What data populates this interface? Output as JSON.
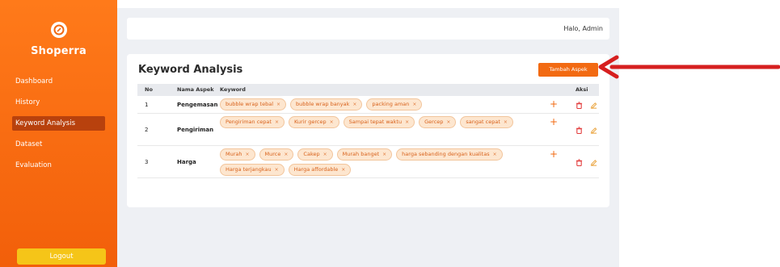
{
  "sidebar": {
    "brand": "Shoperra",
    "items": [
      {
        "label": "Dashboard"
      },
      {
        "label": "History"
      },
      {
        "label": "Keyword Analysis",
        "active": true
      },
      {
        "label": "Dataset"
      },
      {
        "label": "Evaluation"
      }
    ],
    "logout": "Logout"
  },
  "header": {
    "greeting": "Halo, Admin"
  },
  "card": {
    "title": "Keyword Analysis",
    "add_button": "Tambah Aspek",
    "columns": [
      "No",
      "Nama Aspek",
      "Keyword",
      "Aksi"
    ],
    "rows": [
      {
        "no": "1",
        "aspect": "Pengemasan",
        "keywords": [
          "bubble wrap tebal",
          "bubble wrap banyak",
          "packing aman"
        ]
      },
      {
        "no": "2",
        "aspect": "Pengiriman",
        "keywords": [
          "Pengiriman cepat",
          "Kurir gercep",
          "Sampai tepat waktu",
          "Gercep",
          "sangat cepat"
        ]
      },
      {
        "no": "3",
        "aspect": "Harga",
        "keywords": [
          "Murah",
          "Murce",
          "Cakep",
          "Murah banget",
          "harga sebanding dengan kualitas",
          "Harga terjangkau",
          "Harga affordable"
        ]
      }
    ],
    "tag_remove_symbol": "×",
    "add_keyword_symbol": "+"
  },
  "colors": {
    "sidebar": "#f26a12",
    "active_item": "#b8410d",
    "logout": "#f5c518",
    "accent": "#f26a12",
    "tag_bg": "#fde6cf",
    "delete": "#e23b3b",
    "edit": "#e9a23b",
    "arrow": "#d61f1f"
  },
  "icons": {
    "logo": "logo-icon",
    "add": "plus-icon",
    "delete": "trash-icon",
    "edit": "edit-icon"
  }
}
